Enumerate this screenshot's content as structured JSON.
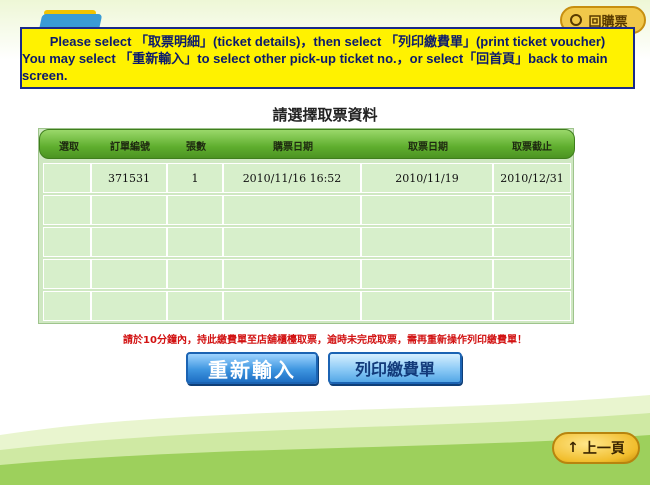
{
  "header": {
    "top_right_button": "回購票"
  },
  "banner": {
    "line1": "Please select 「取票明細」(ticket details)，then select 「列印繳費單」(print ticket voucher)",
    "line2": "You may select 「重新輸入」to select other pick-up ticket no.，or select「回首頁」back to main screen."
  },
  "page_title": "請選擇取票資料",
  "table": {
    "headers": [
      "選取",
      "訂單編號",
      "張數",
      "購票日期",
      "取票日期",
      "取票截止"
    ],
    "rows": [
      [
        "",
        "371531",
        "1",
        "2010/11/16 16:52",
        "2010/11/19",
        "2010/12/31"
      ],
      [
        "",
        "",
        "",
        "",
        "",
        ""
      ],
      [
        "",
        "",
        "",
        "",
        "",
        ""
      ],
      [
        "",
        "",
        "",
        "",
        "",
        ""
      ],
      [
        "",
        "",
        "",
        "",
        "",
        ""
      ]
    ]
  },
  "notice": "請於10分鐘內，持此繳費單至店舖櫃檯取票，逾時未完成取票，需再重新操作列印繳費單！",
  "buttons": {
    "reenter": "重新輸入",
    "print": "列印繳費單",
    "prev": "上一頁",
    "prev_icon": "↑"
  },
  "colors": {
    "banner_bg": "#fff200",
    "table_header": "#5fae2e",
    "cell_bg": "#d7efcb",
    "notice": "#d21212",
    "button_blue": "#3f96e0",
    "button_gold": "#f1bd2c"
  }
}
